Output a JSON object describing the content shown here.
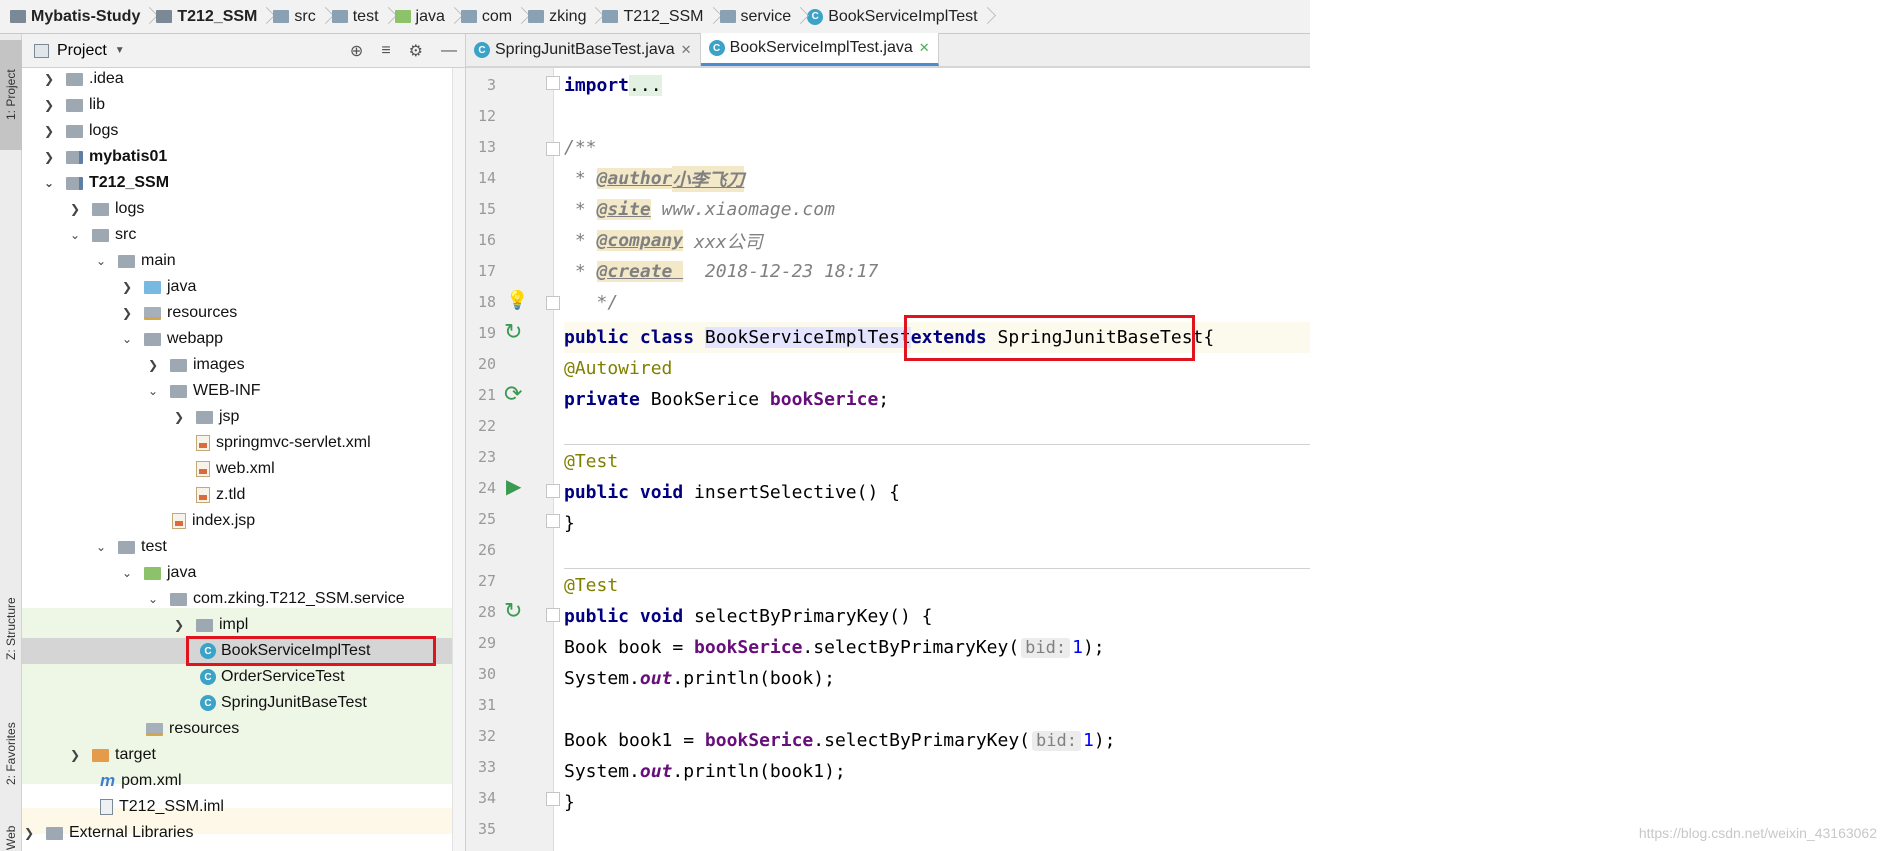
{
  "breadcrumb": [
    {
      "label": "Mybatis-Study",
      "icon": "module-icon"
    },
    {
      "label": "T212_SSM",
      "icon": "module-icon"
    },
    {
      "label": "src",
      "icon": "folder-icon"
    },
    {
      "label": "test",
      "icon": "folder-icon"
    },
    {
      "label": "java",
      "icon": "folder-icon"
    },
    {
      "label": "com",
      "icon": "package-icon"
    },
    {
      "label": "zking",
      "icon": "package-icon"
    },
    {
      "label": "T212_SSM",
      "icon": "package-icon"
    },
    {
      "label": "service",
      "icon": "package-icon"
    },
    {
      "label": "BookServiceImplTest",
      "icon": "class-icon"
    }
  ],
  "side_tabs": [
    "1: Project",
    "Z: Structure",
    "2: Favorites",
    "Web"
  ],
  "project": {
    "title": "Project",
    "tree": [
      {
        "label": ".idea",
        "arrow": ">"
      },
      {
        "label": "lib",
        "arrow": ">"
      },
      {
        "label": "logs",
        "arrow": ">"
      },
      {
        "label": "mybatis01",
        "arrow": ">"
      },
      {
        "label": "T212_SSM",
        "arrow": "v"
      },
      {
        "label": "logs",
        "arrow": ">"
      },
      {
        "label": "src",
        "arrow": "v"
      },
      {
        "label": "main",
        "arrow": "v"
      },
      {
        "label": "java",
        "arrow": ">"
      },
      {
        "label": "resources",
        "arrow": ">"
      },
      {
        "label": "webapp",
        "arrow": "v"
      },
      {
        "label": "images",
        "arrow": ">"
      },
      {
        "label": "WEB-INF",
        "arrow": "v"
      },
      {
        "label": "jsp",
        "arrow": ">"
      },
      {
        "label": "springmvc-servlet.xml",
        "arrow": ""
      },
      {
        "label": "web.xml",
        "arrow": ""
      },
      {
        "label": "z.tld",
        "arrow": ""
      },
      {
        "label": "index.jsp",
        "arrow": ""
      },
      {
        "label": "test",
        "arrow": "v"
      },
      {
        "label": "java",
        "arrow": "v"
      },
      {
        "label": "com.zking.T212_SSM.service",
        "arrow": "v"
      },
      {
        "label": "impl",
        "arrow": ">"
      },
      {
        "label": "BookServiceImplTest",
        "arrow": ""
      },
      {
        "label": "OrderServiceTest",
        "arrow": ""
      },
      {
        "label": "SpringJunitBaseTest",
        "arrow": ""
      },
      {
        "label": "resources",
        "arrow": ""
      },
      {
        "label": "target",
        "arrow": ">"
      },
      {
        "label": "pom.xml",
        "arrow": ""
      },
      {
        "label": "T212_SSM.iml",
        "arrow": ""
      },
      {
        "label": "External Libraries",
        "arrow": ">"
      }
    ]
  },
  "editor": {
    "tabs": [
      {
        "label": "SpringJunitBaseTest.java",
        "active": false
      },
      {
        "label": "BookServiceImplTest.java",
        "active": true
      }
    ],
    "line_numbers": [
      "3",
      "12",
      "13",
      "14",
      "15",
      "16",
      "17",
      "18",
      "19",
      "20",
      "21",
      "22",
      "23",
      "24",
      "25",
      "26",
      "27",
      "28",
      "29",
      "30",
      "31",
      "32",
      "33",
      "34",
      "35"
    ],
    "code": {
      "import": "import",
      "import_fold": "...",
      "doc_open": "/**",
      "author_tag": "@author",
      "author_val": "小李飞刀",
      "site_tag": "@site",
      "site_val": " www.xiaomage.com",
      "company_tag": "@company",
      "company_val": " xxx公司",
      "create_tag": "@create ",
      "create_val": "  2018-12-23 18:17",
      "doc_close": "*/",
      "kw_public_class": "public class ",
      "class_name": "BookServiceImplTest",
      "kw_extends": "extends",
      "super_name": " SpringJunitBaseTest",
      "brace_open": "{",
      "autowired": "@Autowired",
      "kw_private": "private",
      "field_type": " BookSerice ",
      "field_name": "bookSerice",
      "semicolon": ";",
      "test_ann": "@Test",
      "kw_public_void": "public void",
      "method1": " insertSelective() {",
      "close_brace": "}",
      "method2": " selectByPrimaryKey() {",
      "book_decl": "Book book = ",
      "book1_decl": "Book book1 = ",
      "call": ".selectByPrimaryKey(",
      "hint": "bid:",
      "one": "1",
      "call_end": ");",
      "sys": "System.",
      "out": "out",
      "println_book": ".println(book);",
      "println_book1": ".println(book1);"
    }
  },
  "watermark": "https://blog.csdn.net/weixin_43163062"
}
